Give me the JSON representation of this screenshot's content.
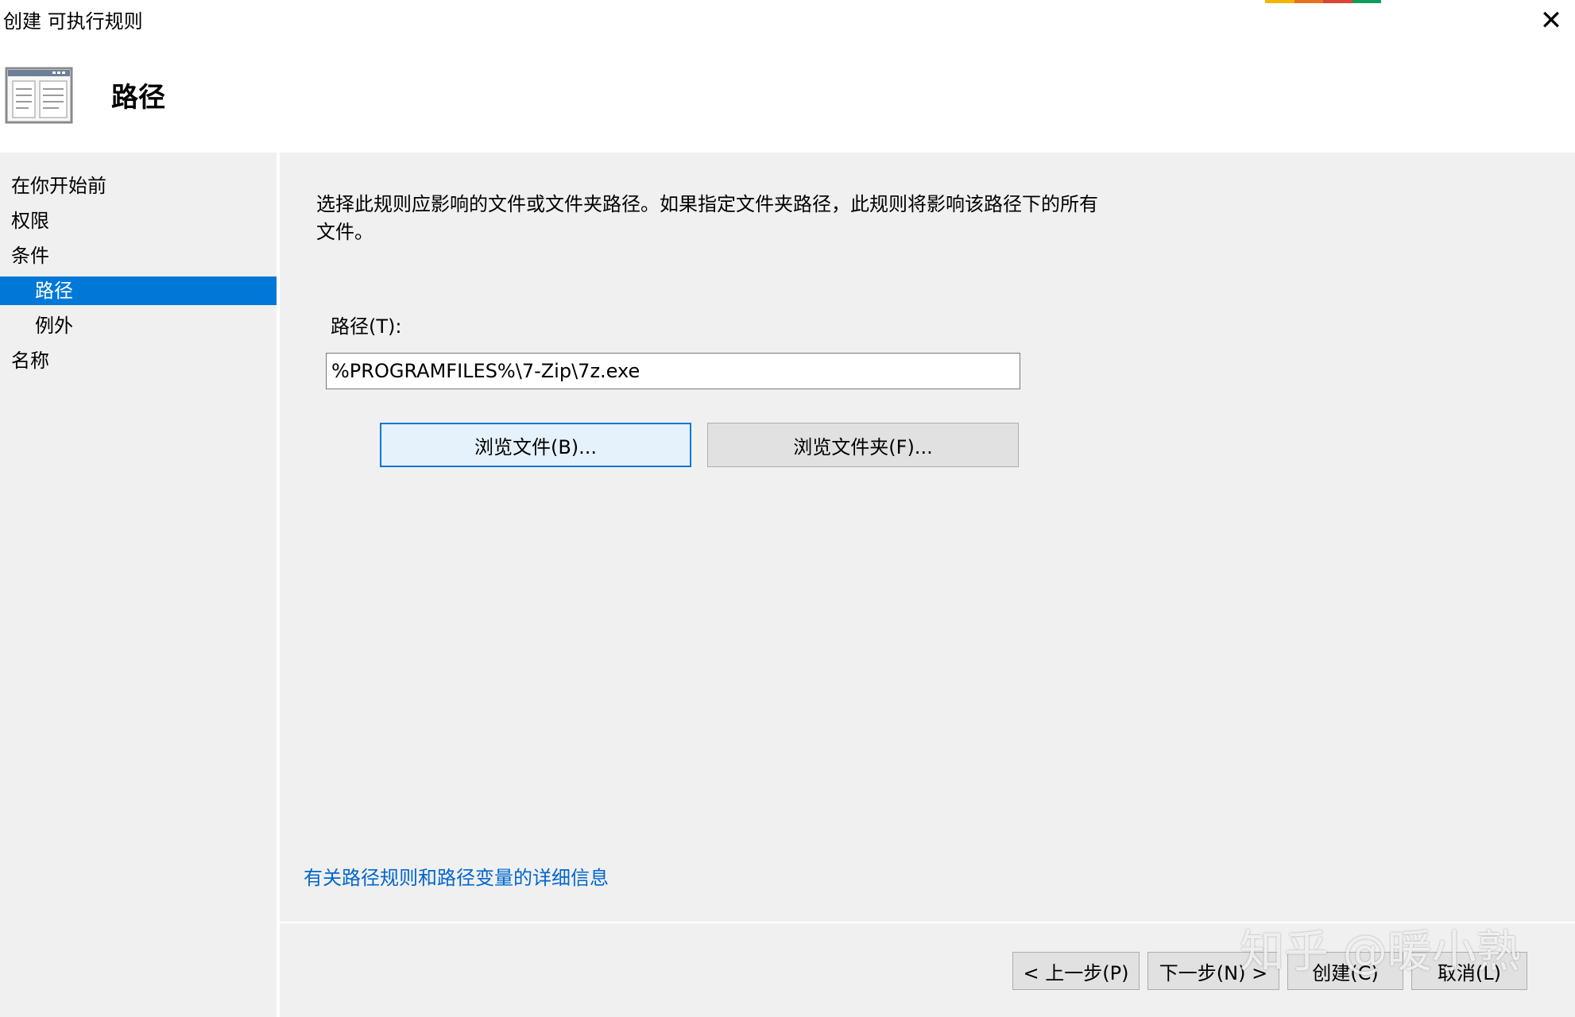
{
  "window": {
    "title": "创建 可执行规则",
    "close_icon": "close-icon"
  },
  "header": {
    "page_title": "路径",
    "icon": "rule-wizard-icon"
  },
  "steps": [
    {
      "label": "在你开始前",
      "level": 0,
      "selected": false
    },
    {
      "label": "权限",
      "level": 0,
      "selected": false
    },
    {
      "label": "条件",
      "level": 0,
      "selected": false
    },
    {
      "label": "路径",
      "level": 1,
      "selected": true
    },
    {
      "label": "例外",
      "level": 1,
      "selected": false
    },
    {
      "label": "名称",
      "level": 0,
      "selected": false
    }
  ],
  "main": {
    "description": "选择此规则应影响的文件或文件夹路径。如果指定文件夹路径，此规则将影响该路径下的所有文件。",
    "path_label": "路径(T):",
    "path_value": "%PROGRAMFILES%\\7-Zip\\7z.exe",
    "browse_file_label": "浏览文件(B)...",
    "browse_folder_label": "浏览文件夹(F)...",
    "help_link": "有关路径规则和路径变量的详细信息"
  },
  "footer": {
    "back_label": "< 上一步(P)",
    "next_label": "下一步(N) >",
    "create_label": "创建(C)",
    "cancel_label": "取消(L)"
  },
  "watermark": "知乎 @暖小熟",
  "colors": {
    "accent": "#0078d7",
    "link": "#0066cc",
    "background": "#f0f0f0"
  }
}
